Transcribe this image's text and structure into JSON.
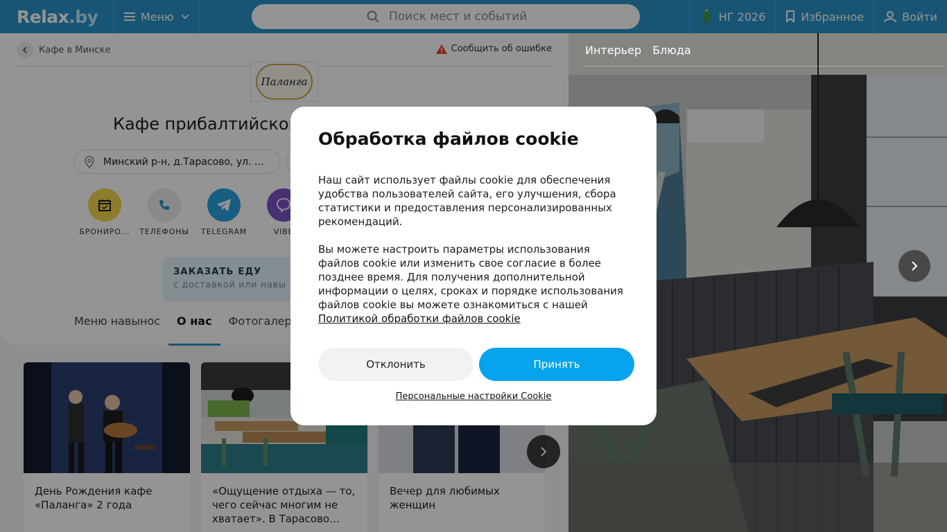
{
  "header": {
    "logo_text": "Relax",
    "logo_suffix": ".by",
    "menu_label": "Меню",
    "search_placeholder": "Поиск мест и событий",
    "ng_label": "НГ 2026",
    "favorites_label": "Избранное",
    "login_label": "Войти"
  },
  "breadcrumb": {
    "label": "Кафе в Минске"
  },
  "report_label": "Сообщить об ошибке",
  "venue": {
    "logo_text": "Паланга",
    "title": "Кафе прибалтийской",
    "address": "Минский р-н, д.Тарасово, ул. ..."
  },
  "actions": [
    {
      "label": "БРОНИРО...",
      "icon": "calendar-icon",
      "color": "#f2d64a"
    },
    {
      "label": "ТЕЛЕФОНЫ",
      "icon": "phone-icon",
      "color": "#ececec"
    },
    {
      "label": "TELEGRAM",
      "icon": "telegram-icon",
      "color": "#2aa3e0"
    },
    {
      "label": "VIBE",
      "icon": "viber-icon",
      "color": "#7b51c9"
    }
  ],
  "order": {
    "title": "ЗАКАЗАТЬ ЕДУ",
    "subtitle": "с доставкой или навы"
  },
  "tabs": [
    "Меню навынос",
    "О нас",
    "Фотогалерея"
  ],
  "news": [
    {
      "title": "День Рождения кафе «Паланга» 2 года"
    },
    {
      "title": "«Ощущение отдыха — то, чего сейчас многим не хватает». В Тарасово…"
    },
    {
      "title": "Вечер для любимых женщин"
    }
  ],
  "photo_tabs": [
    "Интерьер",
    "Блюда"
  ],
  "cookie": {
    "title": "Обработка файлов cookie",
    "text1": "Наш сайт использует файлы cookie для обеспечения удобства пользователей сайта, его улучшения, сбора статистики и предоставления персонализированных рекомендаций.",
    "text2": "Вы можете настроить параметры использования файлов cookie или изменить свое согласие в более позднее время. Для получения дополнительной информации о целях, сроках и порядке использования файлов cookie вы можете ознакомиться с нашей",
    "policy_link": "Политикой обработки файлов cookie",
    "decline": "Отклонить",
    "accept": "Принять",
    "personal": "Персональные настройки Cookie"
  },
  "colors": {
    "brand": "#2a93c9",
    "accept": "#06a4ec"
  }
}
